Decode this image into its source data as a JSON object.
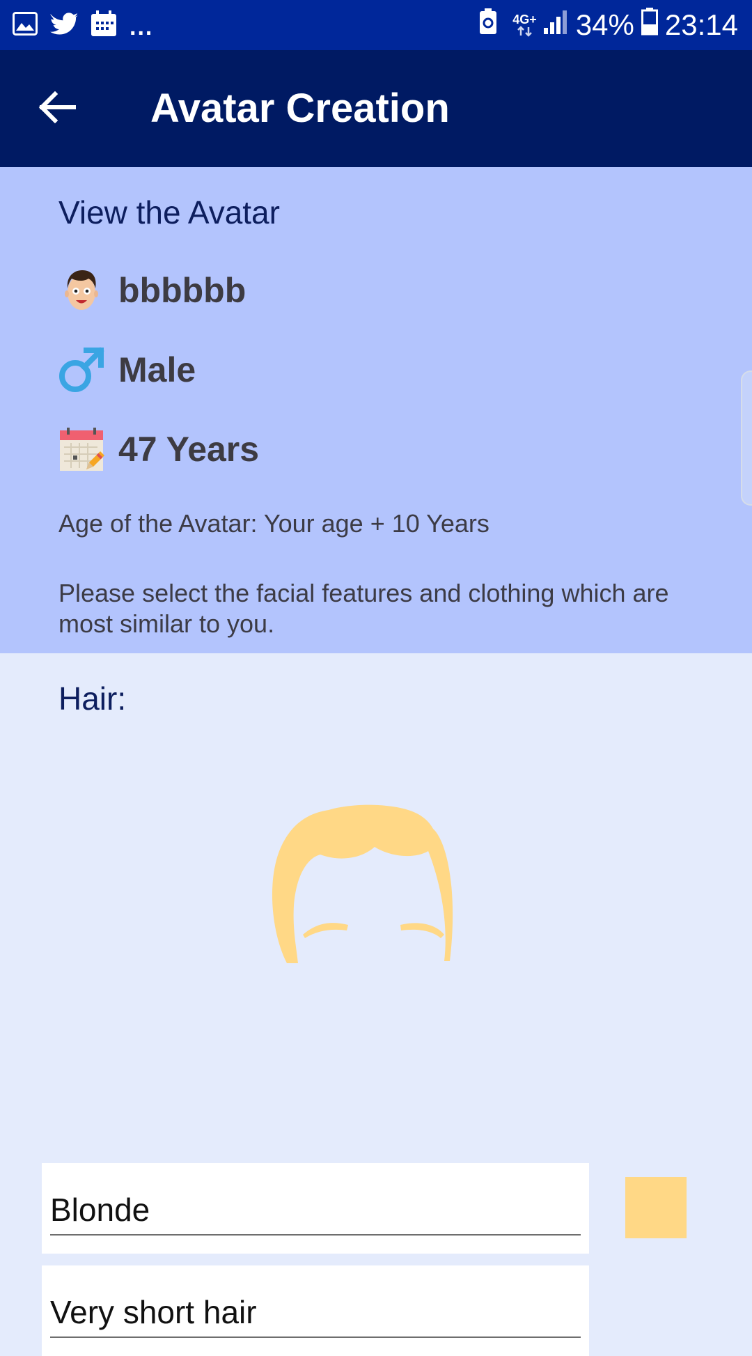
{
  "status_bar": {
    "overflow_dots": "...",
    "network_label_top": "4G+",
    "battery_percent": "34%",
    "time": "23:14",
    "icons": [
      "gallery-icon",
      "twitter-icon",
      "calendar-icon",
      "battery-saver-icon",
      "network-4g-icon",
      "signal-icon",
      "battery-icon"
    ]
  },
  "app_bar": {
    "title": "Avatar Creation",
    "back_icon": "arrow-left-icon"
  },
  "info_panel": {
    "heading": "View the Avatar",
    "name": "bbbbbb",
    "gender": "Male",
    "age": "47 Years",
    "age_note": "Age of the Avatar: Your age + 10 Years",
    "instruction": "Please select the facial features and clothing which are most similar to you.",
    "icons": [
      "face-avatar-icon",
      "male-symbol-icon",
      "calendar-pencil-icon"
    ]
  },
  "hair_section": {
    "heading": "Hair:",
    "color_value": "Blonde",
    "style_value": "Very short hair",
    "swatch_color": "#ffd886"
  },
  "colors": {
    "status_bar": "#00279a",
    "app_bar": "#001a63",
    "info_panel": "#b3c4fd",
    "page_background": "#e4ebfc",
    "hair": "#ffd886"
  }
}
